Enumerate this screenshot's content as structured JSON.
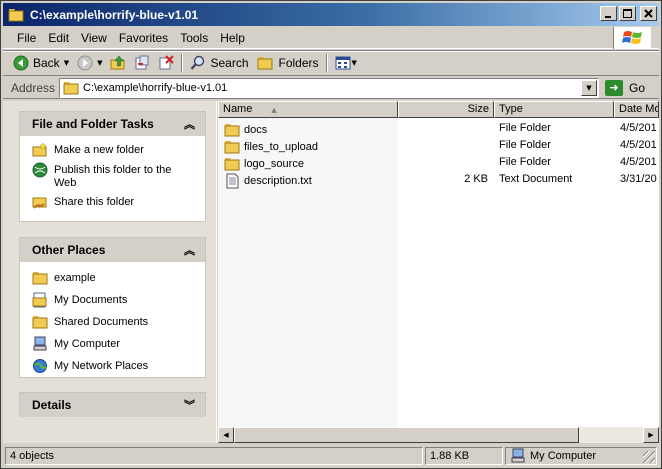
{
  "window": {
    "title": "C:\\example\\horrify-blue-v1.01",
    "caption_buttons": [
      "minimize",
      "maximize",
      "close"
    ]
  },
  "menu": [
    "File",
    "Edit",
    "View",
    "Favorites",
    "Tools",
    "Help"
  ],
  "toolbar": {
    "back_label": "Back",
    "search_label": "Search",
    "folders_label": "Folders"
  },
  "address": {
    "label": "Address",
    "value": "C:\\example\\horrify-blue-v1.01",
    "go_label": "Go"
  },
  "file_tasks": {
    "title": "File and Folder Tasks",
    "items": [
      {
        "label": "Make a new folder",
        "icon": "new-folder-icon"
      },
      {
        "label": "Publish this folder to the Web",
        "icon": "publish-web-icon"
      },
      {
        "label": "Share this folder",
        "icon": "share-folder-icon"
      }
    ]
  },
  "other_places": {
    "title": "Other Places",
    "items": [
      {
        "label": "example",
        "icon": "folder-icon"
      },
      {
        "label": "My Documents",
        "icon": "my-documents-icon"
      },
      {
        "label": "Shared Documents",
        "icon": "folder-icon"
      },
      {
        "label": "My Computer",
        "icon": "computer-icon"
      },
      {
        "label": "My Network Places",
        "icon": "network-places-icon"
      }
    ]
  },
  "details": {
    "title": "Details"
  },
  "columns": [
    "Name",
    "Size",
    "Type",
    "Date Mo"
  ],
  "files": [
    {
      "name": "docs",
      "size": "",
      "type": "File Folder",
      "date": "4/5/201",
      "icon": "folder-icon"
    },
    {
      "name": "files_to_upload",
      "size": "",
      "type": "File Folder",
      "date": "4/5/201",
      "icon": "folder-icon"
    },
    {
      "name": "logo_source",
      "size": "",
      "type": "File Folder",
      "date": "4/5/201",
      "icon": "folder-icon"
    },
    {
      "name": "description.txt",
      "size": "2 KB",
      "type": "Text Document",
      "date": "3/31/20",
      "icon": "text-document-icon"
    }
  ],
  "status": {
    "objects": "4 objects",
    "size": "1.88 KB",
    "location": "My Computer"
  },
  "colors": {
    "title_gradient_start": "#0a246a",
    "title_gradient_end": "#a6caf0",
    "chrome": "#d4d0c8",
    "taskpane_bg": "#e4e0d8",
    "folder_yellow": "#f2cc52"
  }
}
